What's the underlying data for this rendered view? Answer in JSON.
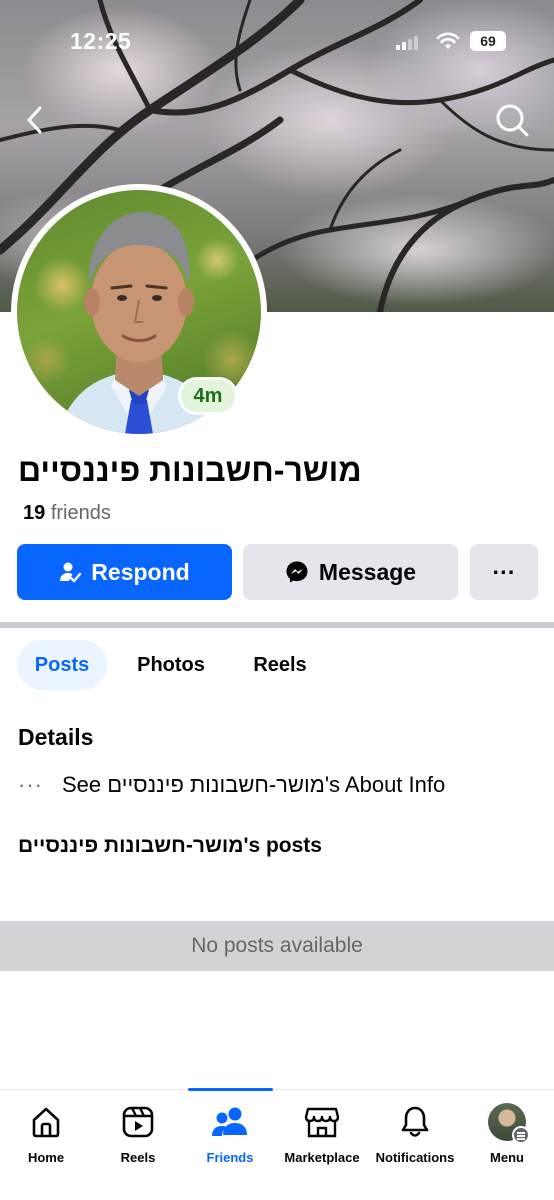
{
  "status_bar": {
    "time": "12:25",
    "battery": "69"
  },
  "profile": {
    "name": "מושר-חשבונות פיננסיים",
    "active_badge": "4m",
    "friends_count": "19",
    "friends_label": "friends"
  },
  "actions": {
    "respond_label": "Respond",
    "message_label": "Message",
    "more_label": "···"
  },
  "tabs": [
    {
      "label": "Posts",
      "selected": true
    },
    {
      "label": "Photos",
      "selected": false
    },
    {
      "label": "Reels",
      "selected": false
    }
  ],
  "details": {
    "title": "Details",
    "about_dots": "···",
    "about_text": "See מושר-חשבונות פיננסיים's About Info"
  },
  "posts": {
    "heading": "מושר-חשבונות פיננסיים's posts",
    "empty_message": "No posts available"
  },
  "bottom_nav": [
    {
      "label": "Home",
      "icon": "home-icon",
      "active": false
    },
    {
      "label": "Reels",
      "icon": "reels-icon",
      "active": false
    },
    {
      "label": "Friends",
      "icon": "friends-icon",
      "active": true
    },
    {
      "label": "Marketplace",
      "icon": "marketplace-icon",
      "active": false
    },
    {
      "label": "Notifications",
      "icon": "bell-icon",
      "active": false
    },
    {
      "label": "Menu",
      "icon": "profile-avatar",
      "active": false
    }
  ],
  "colors": {
    "accent": "#0866ff",
    "button_gray": "#e4e6eb",
    "secondary_text": "#65676b",
    "active_badge_bg": "#e3f4dd"
  }
}
